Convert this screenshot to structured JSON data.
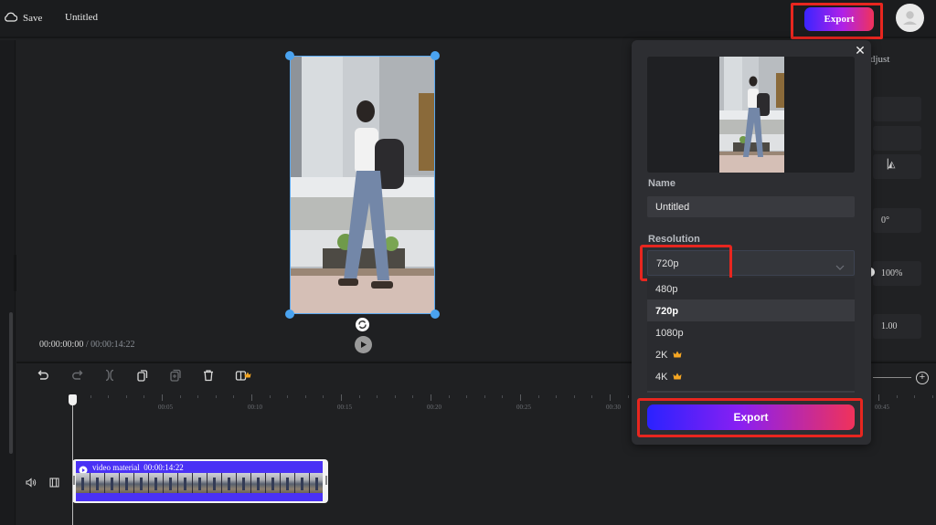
{
  "topbar": {
    "save_label": "Save",
    "title": "Untitled",
    "export_label": "Export"
  },
  "preview": {
    "current_time": "00:00:00:00",
    "separator": " / ",
    "total_time": "00:00:14:22"
  },
  "right_panel": {
    "tab_label": "Adjust",
    "tab_label_visible": "djust",
    "rotation": "0°",
    "opacity": "100%",
    "speed": "1.00"
  },
  "timeline": {
    "tools": [
      "undo",
      "redo",
      "split",
      "duplicate",
      "paste",
      "delete",
      "freeze-frame"
    ],
    "ruler_labels": [
      "00:05",
      "00:10",
      "00:15",
      "00:20",
      "00:25",
      "00:30",
      "00:45"
    ],
    "clip": {
      "title": "video material",
      "duration": "00:00:14:22",
      "color": "#4a31f5"
    }
  },
  "export_dialog": {
    "name_label": "Name",
    "name_value": "Untitled",
    "resolution_label": "Resolution",
    "resolution_selected": "720p",
    "resolution_options": [
      {
        "label": "480p",
        "premium": false,
        "selected": false
      },
      {
        "label": "720p",
        "premium": false,
        "selected": true
      },
      {
        "label": "1080p",
        "premium": false,
        "selected": false
      },
      {
        "label": "2K",
        "premium": true,
        "selected": false
      },
      {
        "label": "4K",
        "premium": true,
        "selected": false
      }
    ],
    "export_label": "Export"
  },
  "colors": {
    "accent_gradient_start": "#3a25ff",
    "accent_gradient_mid": "#b021e8",
    "accent_gradient_end": "#f0325a",
    "highlight_red": "#e8261f",
    "selection_blue": "#4aa3f0",
    "premium_crown": "#f5a623"
  }
}
